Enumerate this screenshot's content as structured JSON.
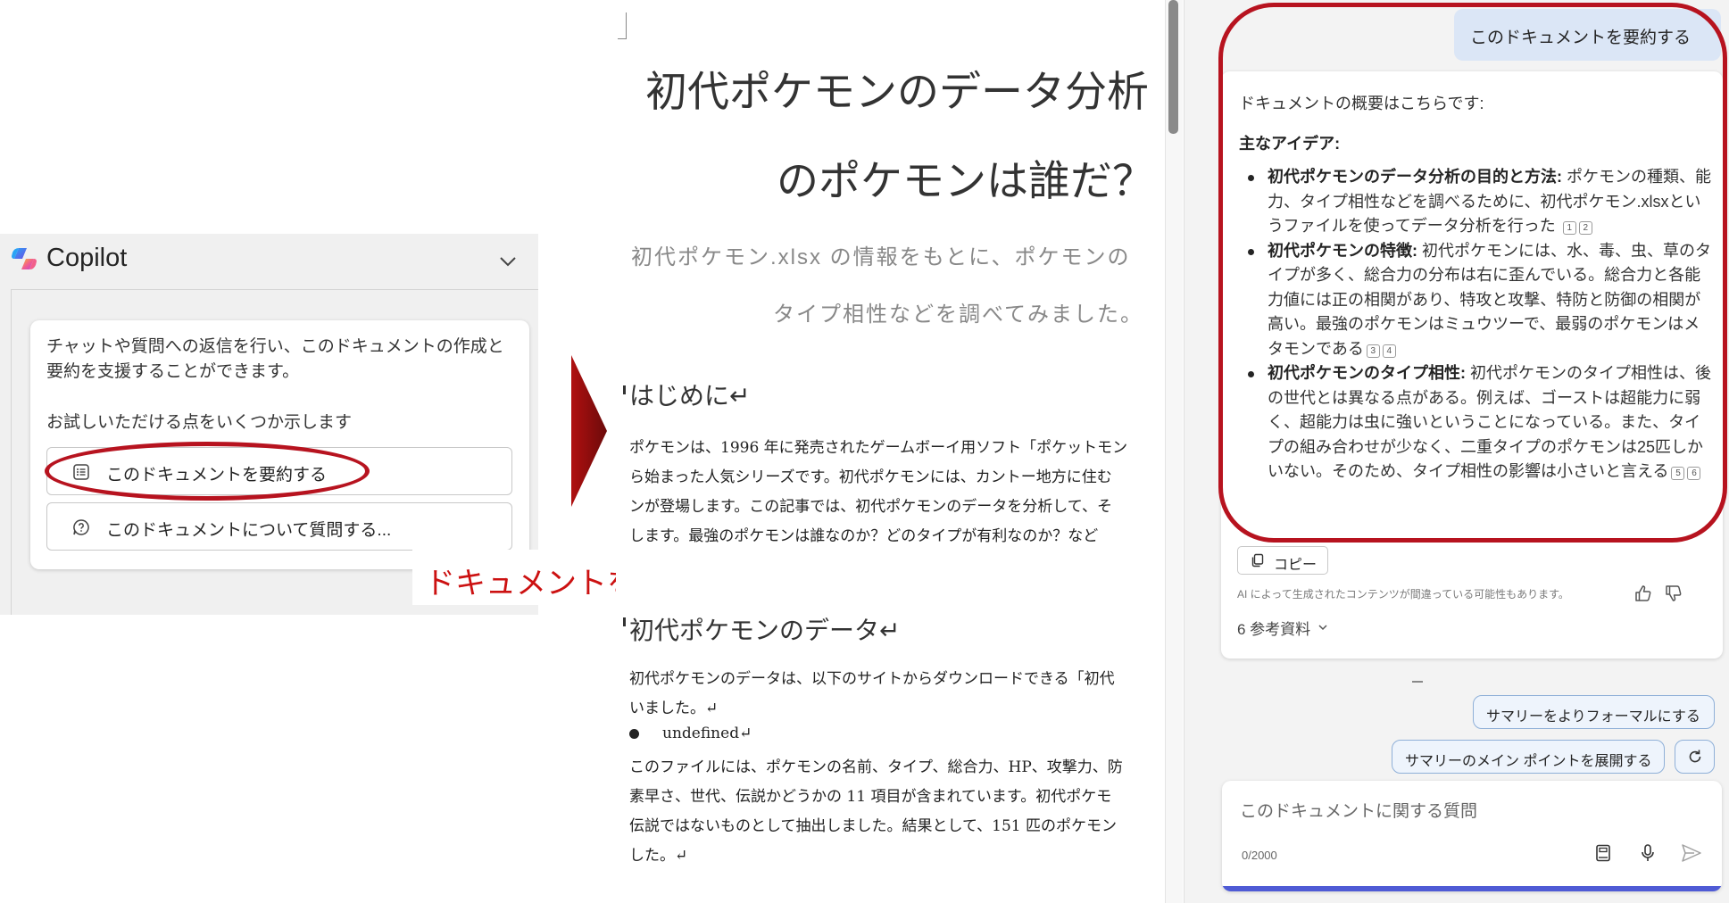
{
  "copilot_panel": {
    "title": "Copilot",
    "welcome": "チャットや質問への返信を行い、このドキュメントの作成と要約を支援することができます。",
    "try_prompt": "お試しいただける点をいくつか示します",
    "suggestions": [
      {
        "label": "このドキュメントを要約する",
        "icon": "list-icon"
      },
      {
        "label": "このドキュメントについて質問する...",
        "icon": "question-chat-icon"
      }
    ]
  },
  "annotation": {
    "caption": "ドキュメントを要約する",
    "highlight_color": "#b7131f",
    "caption_color": "#cc1111"
  },
  "document": {
    "title_line1": "初代ポケモンのデータ分析",
    "title_line2": "のポケモンは誰だ？",
    "subtitle_line1": "初代ポケモン.xlsx の情報をもとに、ポケモンの",
    "subtitle_line2": "タイプ相性などを調べてみました。",
    "heading1": "はじめに↵",
    "intro_lines": [
      "ポケモンは、1996 年に発売されたゲームボーイ用ソフト「ポケットモン",
      "ら始まった人気シリーズです。初代ポケモンには、カントー地方に住む",
      "ンが登場します。この記事では、初代ポケモンのデータを分析して、そ",
      "します。最強のポケモンは誰なのか？どのタイプが有利なのか？など"
    ],
    "heading2": "初代ポケモンのデータ↵",
    "data_lines": [
      "初代ポケモンのデータは、以下のサイトからダウンロードできる「初代",
      "いました。↵"
    ],
    "bullet": "undefined↵",
    "file_lines": [
      "このファイルには、ポケモンの名前、タイプ、総合力、HP、攻撃力、防",
      "素早さ、世代、伝説かどうかの 11 項目が含まれています。初代ポケモ",
      "伝説ではないものとして抽出しました。結果として、151 匹のポケモン",
      "した。↵"
    ]
  },
  "chat": {
    "user_message": "このドキュメントを要約する",
    "response": {
      "intro": "ドキュメントの概要はこちらです:",
      "heading": "主なアイデア:",
      "items": [
        {
          "title": "初代ポケモンのデータ分析の目的と方法:",
          "text": " ポケモンの種類、能力、タイプ相性などを調べるために、初代ポケモン.xlsxというファイルを使ってデータ分析を行った",
          "citations": [
            "1",
            "2"
          ]
        },
        {
          "title": "初代ポケモンの特徴:",
          "text": " 初代ポケモンには、水、毒、虫、草のタイプが多く、総合力の分布は右に歪んでいる。総合力と各能力値には正の相関があり、特攻と攻撃、特防と防御の相関が高い。最強のポケモンはミュウツーで、最弱のポケモンはメタモンである",
          "citations": [
            "3",
            "4"
          ]
        },
        {
          "title": "初代ポケモンのタイプ相性:",
          "text": " 初代ポケモンのタイプ相性は、後の世代とは異なる点がある。例えば、ゴーストは超能力に弱く、超能力は虫に強いということになっている。また、タイプの組み合わせが少なく、二重タイプのポケモンは25匹しかいない。そのため、タイプ相性の影響は小さいと言える",
          "citations": [
            "5",
            "6"
          ]
        }
      ],
      "copy_label": "コピー",
      "disclaimer": "AI によって生成されたコンテンツが間違っている可能性もあります。",
      "references": "6 参考資料"
    },
    "suggestions": [
      "サマリーをよりフォーマルにする",
      "サマリーのメイン ポイントを展開する"
    ],
    "input": {
      "placeholder": "このドキュメントに関する質問",
      "char_count": "0/2000"
    }
  }
}
